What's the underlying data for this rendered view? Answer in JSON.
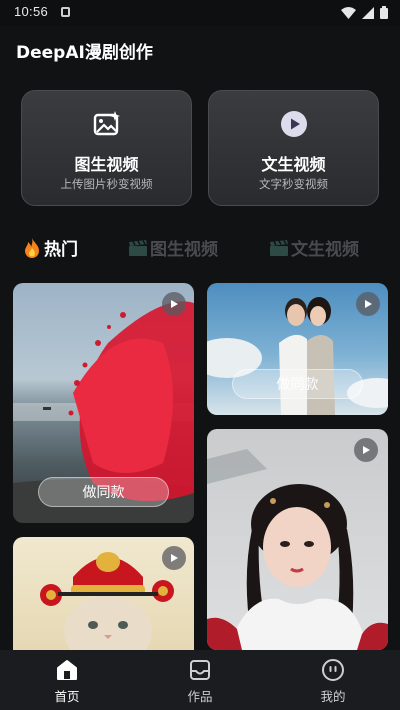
{
  "status": {
    "time": "10:56"
  },
  "header": {
    "title": "DeepAI漫剧创作"
  },
  "cards": [
    {
      "title": "图生视频",
      "subtitle": "上传图片秒变视频",
      "icon": "image-sparkle-icon"
    },
    {
      "title": "文生视频",
      "subtitle": "文字秒变视频",
      "icon": "play-circle-icon"
    }
  ],
  "tabs": [
    {
      "label": "热门",
      "icon": "fire-icon",
      "active": true
    },
    {
      "label": "图生视频",
      "icon": "clapperboard-icon",
      "active": false
    },
    {
      "label": "文生视频",
      "icon": "clapperboard-icon",
      "active": false
    }
  ],
  "feed": {
    "same_label": "做同款"
  },
  "nav": [
    {
      "label": "首页",
      "icon": "home-icon",
      "active": true
    },
    {
      "label": "作品",
      "icon": "inbox-icon",
      "active": false
    },
    {
      "label": "我的",
      "icon": "face-icon",
      "active": false
    }
  ],
  "colors": {
    "background": "#111214",
    "card": "#333437",
    "nav": "#1b1c1f",
    "accent_red": "#e1122d"
  }
}
